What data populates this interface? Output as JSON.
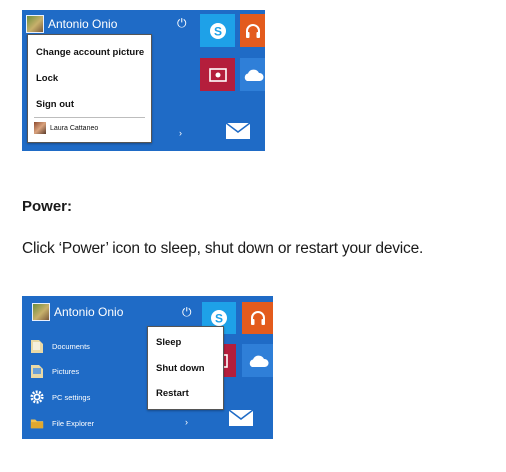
{
  "top_screenshot": {
    "user_name": "Antonio Onio",
    "menu": [
      "Change account picture",
      "Lock",
      "Sign out"
    ],
    "other_user": "Laura Cattaneo",
    "tile_colors": {
      "skype": "#1ea1e8",
      "music": "#e35b1d",
      "video": "#b41e3c",
      "cloud": "#2f7fd8",
      "mail": "#1f6bc6"
    }
  },
  "section": {
    "heading": "Power:",
    "instruction": "Click ‘Power’ icon to sleep, shut down or restart your device."
  },
  "bottom_screenshot": {
    "user_name": "Antonio Onio",
    "power_menu": [
      "Sleep",
      "Shut down",
      "Restart"
    ],
    "start_items": [
      "Documents",
      "Pictures",
      "PC settings",
      "File Explorer"
    ]
  },
  "icons": [
    "power-icon",
    "skype-icon",
    "headphones-icon",
    "video-icon",
    "cloud-icon",
    "mail-icon",
    "folder-icon",
    "gear-icon",
    "chevron-right-icon"
  ]
}
